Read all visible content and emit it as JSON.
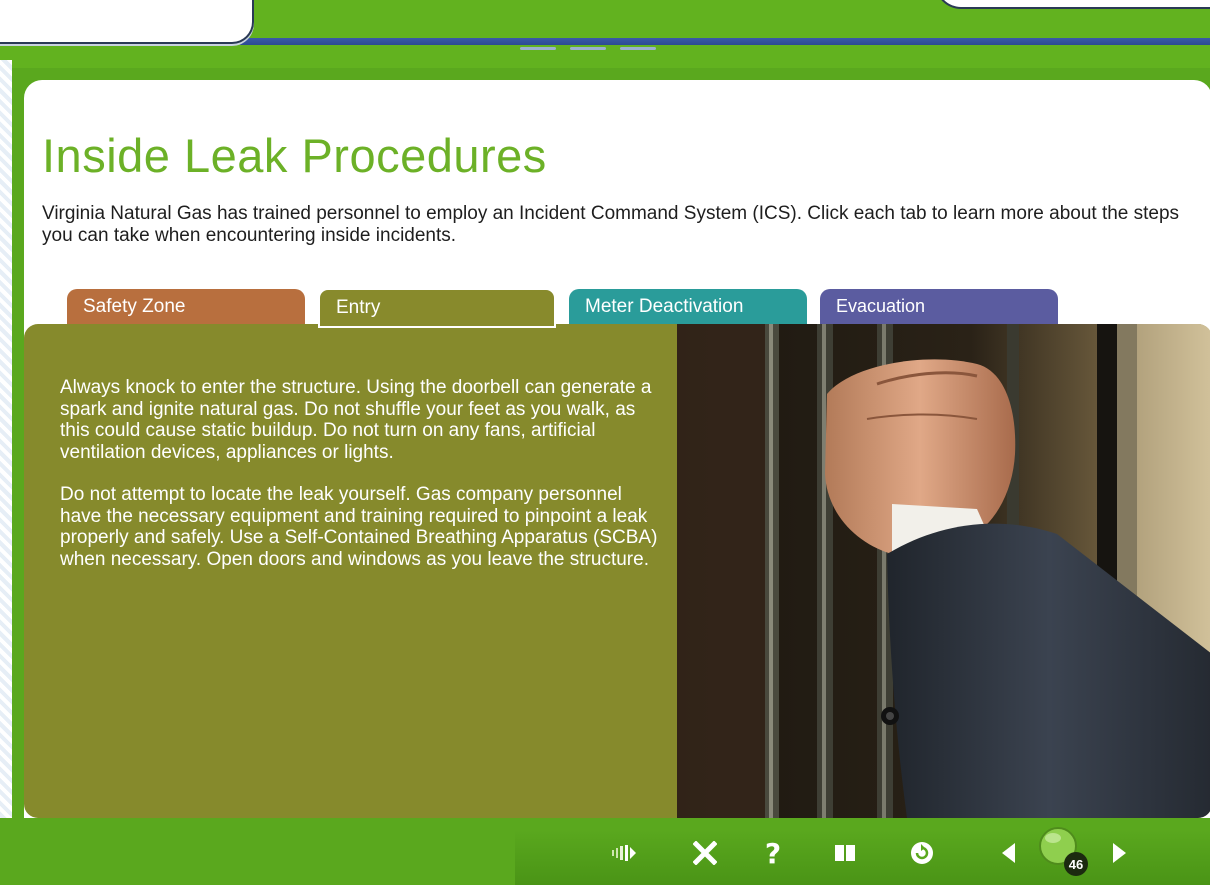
{
  "page": {
    "title": "Inside Leak Procedures",
    "intro": "Virginia Natural Gas has trained personnel to employ an Incident Command System (ICS). Click each tab to learn more about the steps you can take when encountering inside incidents."
  },
  "tabs": [
    {
      "label": "Safety Zone",
      "color": "#b86f3e"
    },
    {
      "label": "Entry",
      "color": "#888a2c",
      "selected": true
    },
    {
      "label": "Meter Deactivation",
      "color": "#2a9c9a"
    },
    {
      "label": "Evacuation",
      "color": "#5b5ca0"
    }
  ],
  "content": {
    "paragraph1": "Always knock to enter the structure. Using the doorbell can generate a spark and ignite natural gas. Do not shuffle your feet as you walk, as this could cause static buildup. Do not turn on any fans, artificial ventilation devices, appliances or lights.",
    "paragraph2": "Do not attempt to locate the leak yourself. Gas company personnel have the necessary equipment and training required to pinpoint a leak properly and safely. Use a Self-Contained Breathing Apparatus (SCBA) when necessary. Open doors and windows as you leave the structure."
  },
  "footer": {
    "icons": [
      "audio-icon",
      "close-icon",
      "help-icon",
      "book-icon",
      "replay-icon",
      "previous-icon",
      "next-icon"
    ],
    "page_number": "46"
  },
  "colors": {
    "brand_green": "#5aa81e",
    "title_green": "#6cb127",
    "content_olive": "#868a2c"
  }
}
